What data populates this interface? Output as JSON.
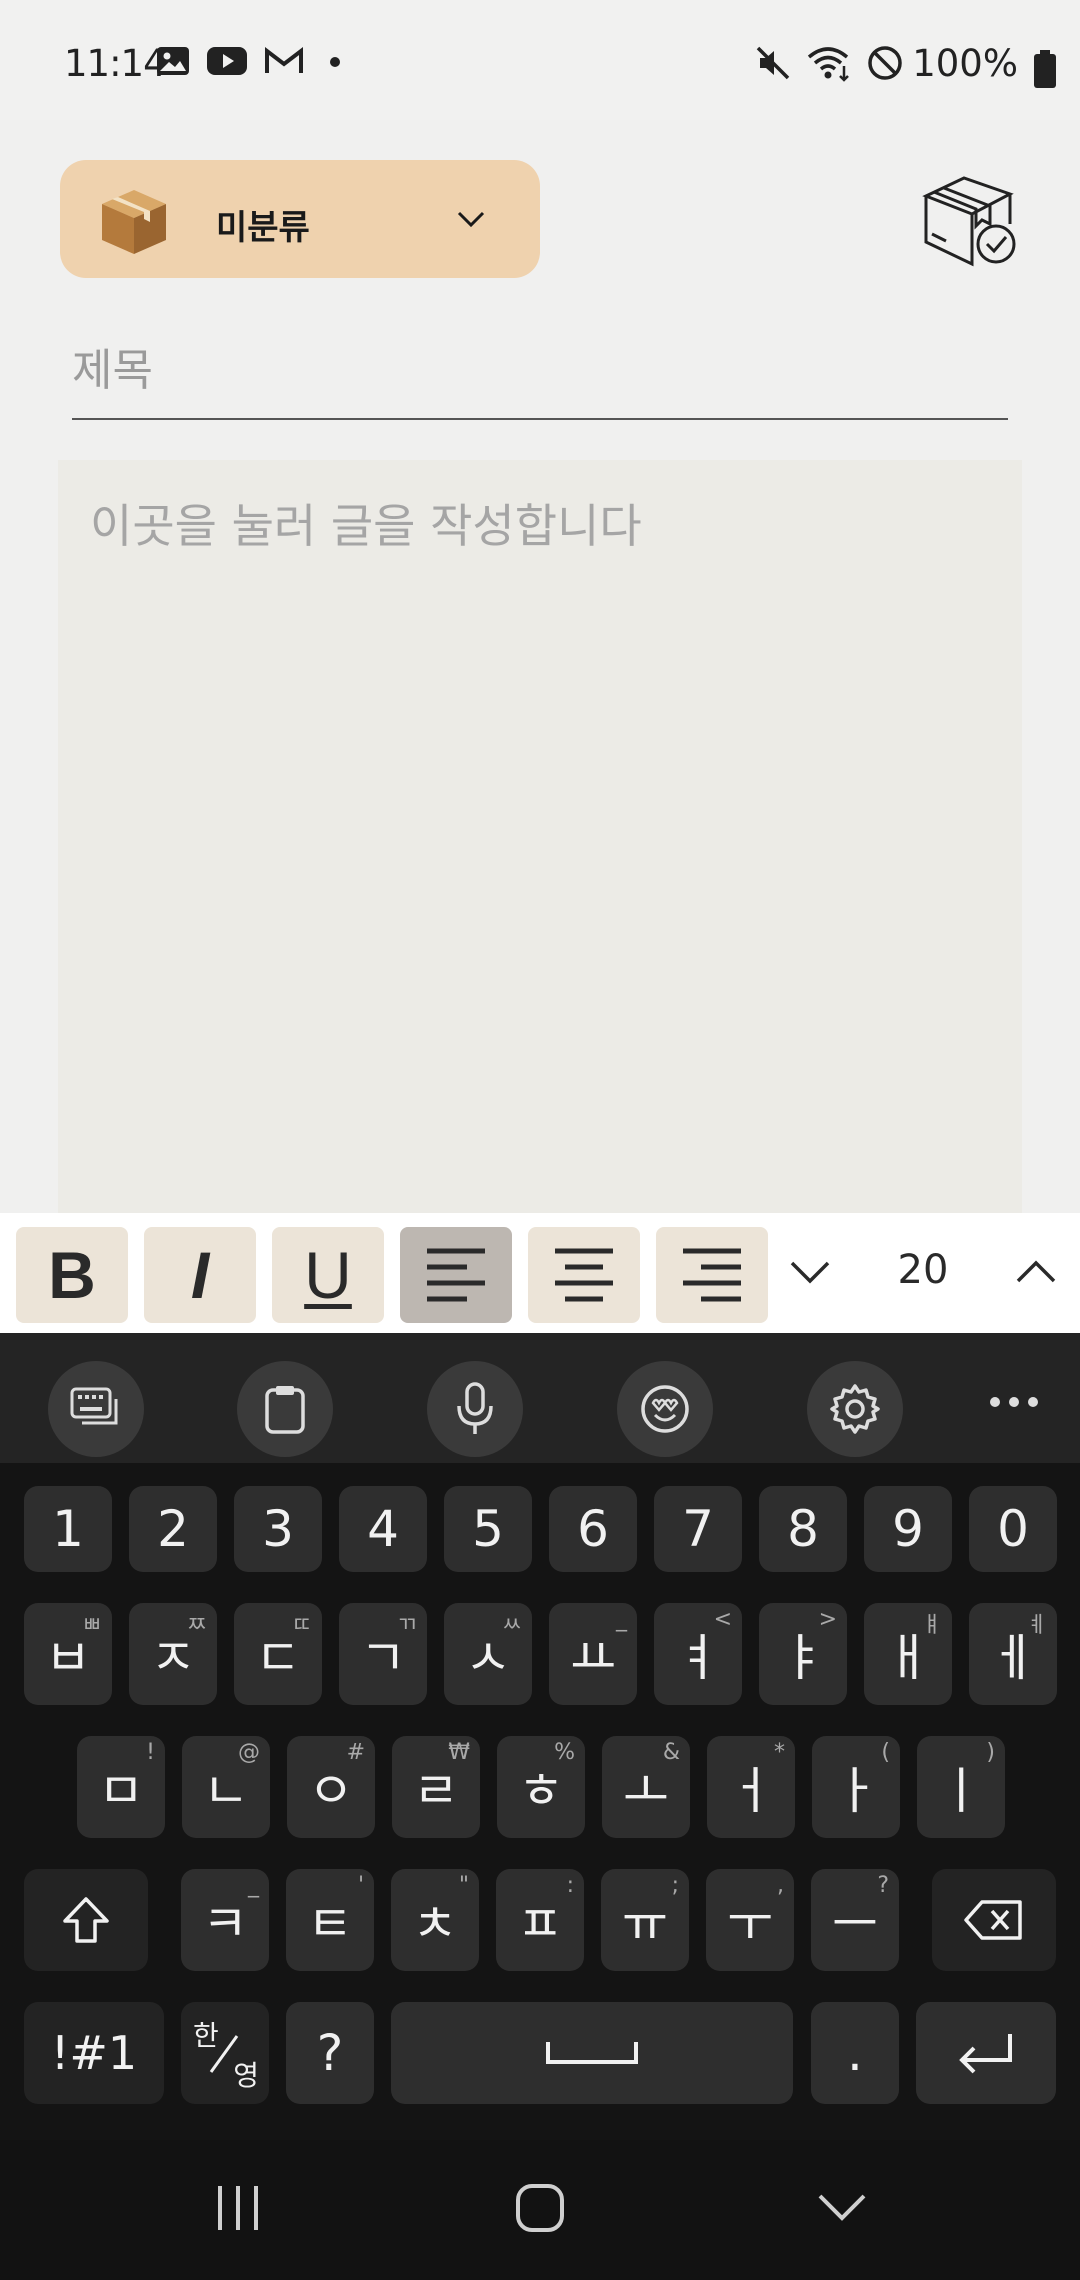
{
  "status_bar": {
    "time": "11:14",
    "left_icons": [
      "gallery-icon",
      "youtube-icon",
      "gmail-icon",
      "dot-icon"
    ],
    "right_icons": [
      "mute-icon",
      "wifi-icon",
      "block-icon",
      "battery-icon"
    ],
    "battery_text": "100%"
  },
  "header": {
    "category_label": "미분류",
    "category_icon": "box-icon",
    "archive_icon": "archive-box-check-icon"
  },
  "editor": {
    "title_placeholder": "제목",
    "title_value": "",
    "body_placeholder": "이곳을 눌러 글을 작성합니다",
    "body_value": ""
  },
  "format_toolbar": {
    "bold_label": "B",
    "italic_label": "I",
    "underline_label": "U",
    "align": "left",
    "font_size": "20"
  },
  "keyboard": {
    "tools": [
      "keyboard-mode-icon",
      "clipboard-icon",
      "microphone-icon",
      "emoji-icon",
      "settings-icon",
      "more-icon"
    ],
    "row_numbers": [
      "1",
      "2",
      "3",
      "4",
      "5",
      "6",
      "7",
      "8",
      "9",
      "0"
    ],
    "row1": [
      {
        "main": "ㅂ",
        "sub": "ㅃ"
      },
      {
        "main": "ㅈ",
        "sub": "ㅉ"
      },
      {
        "main": "ㄷ",
        "sub": "ㄸ"
      },
      {
        "main": "ㄱ",
        "sub": "ㄲ"
      },
      {
        "main": "ㅅ",
        "sub": "ㅆ"
      },
      {
        "main": "ㅛ",
        "sub": "_"
      },
      {
        "main": "ㅕ",
        "sub": "<"
      },
      {
        "main": "ㅑ",
        "sub": ">"
      },
      {
        "main": "ㅐ",
        "sub": "ㅒ"
      },
      {
        "main": "ㅔ",
        "sub": "ㅖ"
      }
    ],
    "row2": [
      {
        "main": "ㅁ",
        "sub": "!"
      },
      {
        "main": "ㄴ",
        "sub": "@"
      },
      {
        "main": "ㅇ",
        "sub": "#"
      },
      {
        "main": "ㄹ",
        "sub": "₩"
      },
      {
        "main": "ㅎ",
        "sub": "%"
      },
      {
        "main": "ㅗ",
        "sub": "&"
      },
      {
        "main": "ㅓ",
        "sub": "*"
      },
      {
        "main": "ㅏ",
        "sub": "("
      },
      {
        "main": "ㅣ",
        "sub": ")"
      }
    ],
    "row3": [
      {
        "main": "ㅋ",
        "sub": "_"
      },
      {
        "main": "ㅌ",
        "sub": "'"
      },
      {
        "main": "ㅊ",
        "sub": "\""
      },
      {
        "main": "ㅍ",
        "sub": ":"
      },
      {
        "main": "ㅠ",
        "sub": ";"
      },
      {
        "main": "ㅜ",
        "sub": ","
      },
      {
        "main": "ㅡ",
        "sub": "?"
      }
    ],
    "sym_label": "!#1",
    "lang_top": "한",
    "lang_bottom": "영",
    "question_label": "?",
    "period_label": "."
  },
  "nav_bar": {
    "icons": [
      "recent-apps-icon",
      "home-icon",
      "hide-keyboard-icon"
    ]
  }
}
